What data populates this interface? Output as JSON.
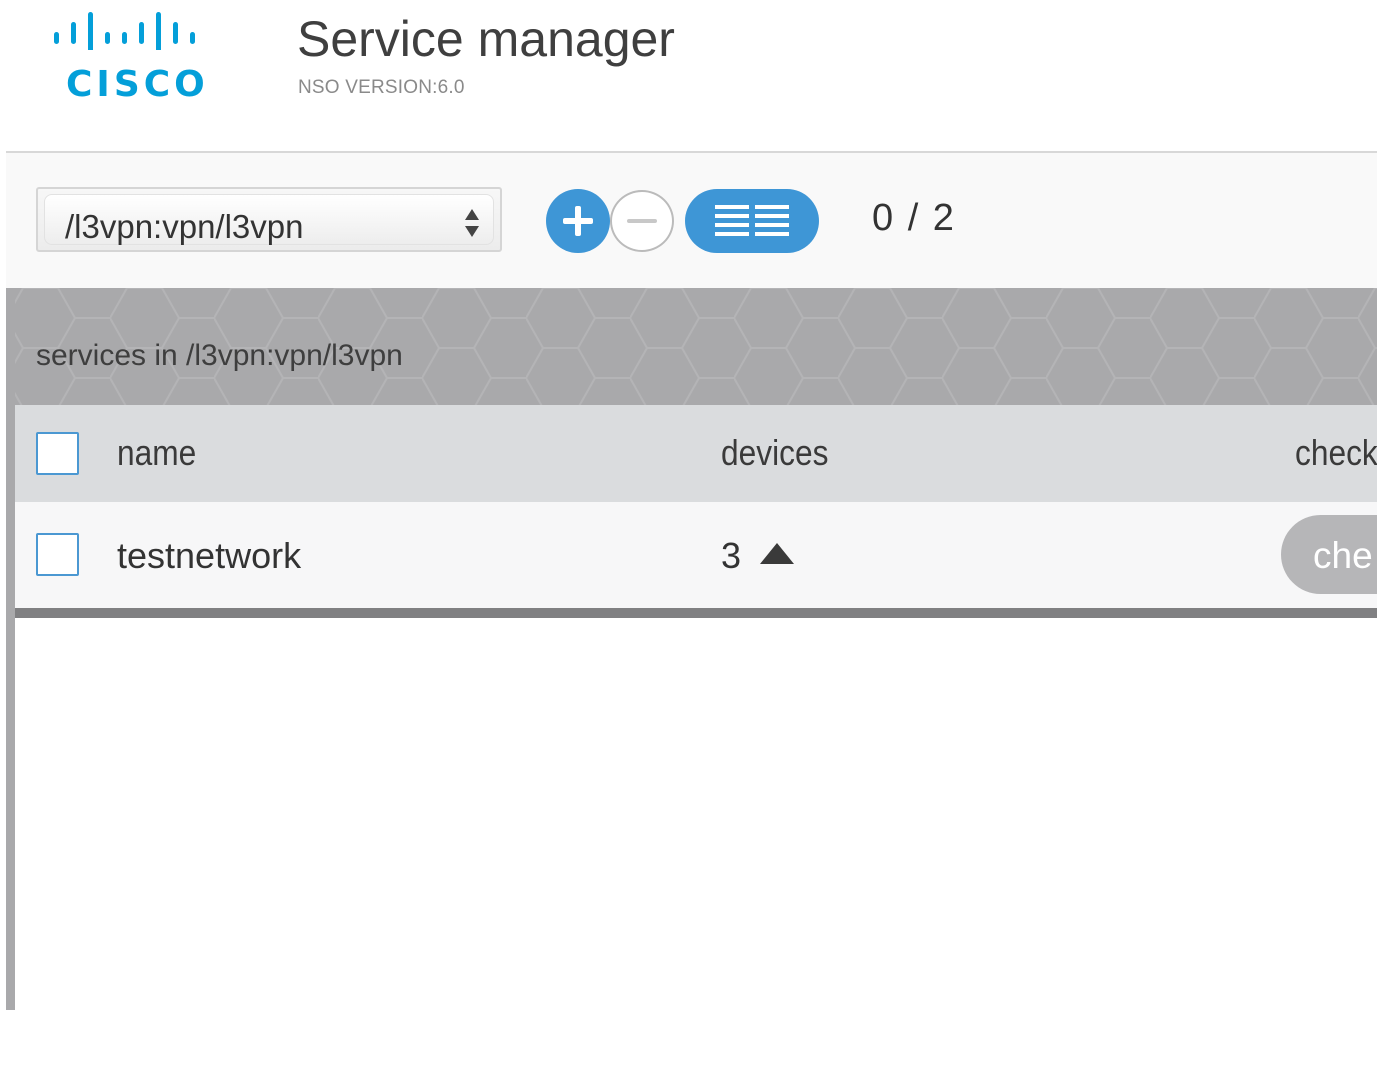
{
  "header": {
    "logo_text": "CISCO",
    "title": "Service manager",
    "version": "NSO VERSION:6.0"
  },
  "toolbar": {
    "service_path_select": "/l3vpn:vpn/l3vpn",
    "add_icon": "plus-circle-icon",
    "remove_icon": "minus-circle-icon",
    "view_icon": "list-view-icon",
    "counter": "0 / 2"
  },
  "panel": {
    "title": "services in /l3vpn:vpn/l3vpn"
  },
  "table": {
    "columns": [
      "name",
      "devices",
      "check"
    ],
    "rows": [
      {
        "name": "testnetwork",
        "devices": "3",
        "action_label": "che"
      }
    ]
  },
  "colors": {
    "accent": "#3e96d6",
    "cisco_blue": "#049fd9",
    "panel_gray": "#a9a9ab",
    "header_row": "#dadcde",
    "check_button": "#b6b6b8"
  }
}
